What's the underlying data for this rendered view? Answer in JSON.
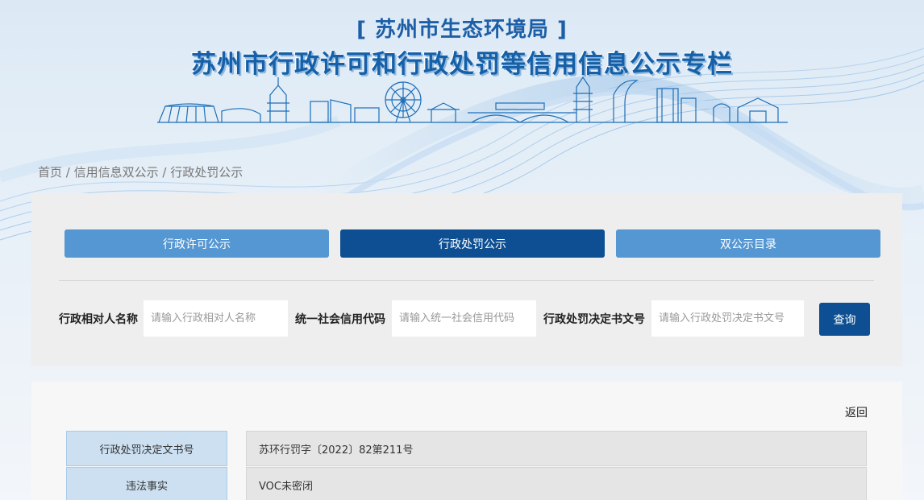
{
  "header": {
    "org": "[ 苏州市生态环境局 ]",
    "title": "苏州市行政许可和行政处罚等信用信息公示专栏"
  },
  "breadcrumb": {
    "home": "首页",
    "sep1": " / ",
    "level2": "信用信息双公示",
    "sep2": " / ",
    "current": "行政处罚公示"
  },
  "tabs": [
    {
      "label": "行政许可公示",
      "active": false
    },
    {
      "label": "行政处罚公示",
      "active": true
    },
    {
      "label": "双公示目录",
      "active": false
    }
  ],
  "search": {
    "name_label": "行政相对人名称",
    "name_placeholder": "请输入行政相对人名称",
    "code_label": "统一社会信用代码",
    "code_placeholder": "请输入统一社会信用代码",
    "doc_label": "行政处罚决定书文号",
    "doc_placeholder": "请输入行政处罚决定书文号",
    "button": "查询"
  },
  "detail": {
    "back": "返回",
    "rows": [
      {
        "key": "行政处罚决定文书号",
        "value": "苏环行罚字〔2022〕82第211号"
      },
      {
        "key": "违法事实",
        "value": "VOC未密闭"
      }
    ]
  },
  "colors": {
    "primary": "#0d4f92",
    "tab_inactive": "#5497d2",
    "title": "#1560a8"
  }
}
